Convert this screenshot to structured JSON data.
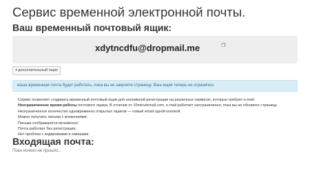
{
  "header": {
    "title": "Сервис временной электронной почты.",
    "subtitle": "Ваш временный почтовый ящик:"
  },
  "mailbox": {
    "email": "xdytncdfu@dropmail.me",
    "copy_icon": "copy-icon"
  },
  "buttons": {
    "add_address": "дополнительный ящик"
  },
  "alert": {
    "text": "ваша временная почта будет работать, пока вы не закроете страницу. Ваш ящик теперь не ограничен"
  },
  "features": [
    {
      "bold": "",
      "text": "Сервис позволяет создавать временный почтовый ящик для анонимной регистрации на различных сервисах, которые требуют e-mail."
    },
    {
      "bold": "Неограниченное время работы",
      "text": " почтового ящика. В отличие от 10minutemail.com, e-mail работает неограниченно, пока вы не обновите страницу."
    },
    {
      "bold": "",
      "text": "Неограниченное количество одновременно открытых ящиков — новый email одной кнопкой."
    },
    {
      "bold": "",
      "text": "Можно получать письма с вложениями."
    },
    {
      "bold": "",
      "text": "Письма отображаются мгновенно!"
    },
    {
      "bold": "",
      "text": "Почта работает без регистрации."
    },
    {
      "bold": "",
      "text": "Нет проблем с кодировками и хакерами."
    }
  ],
  "inbox": {
    "title": "Входящая почта:",
    "empty_text": "Пока ничего не пришло..."
  },
  "colors": {
    "alert_bg": "#d9edf7",
    "alert_text": "#31708f",
    "email_box_bg": "#eeeeee"
  }
}
